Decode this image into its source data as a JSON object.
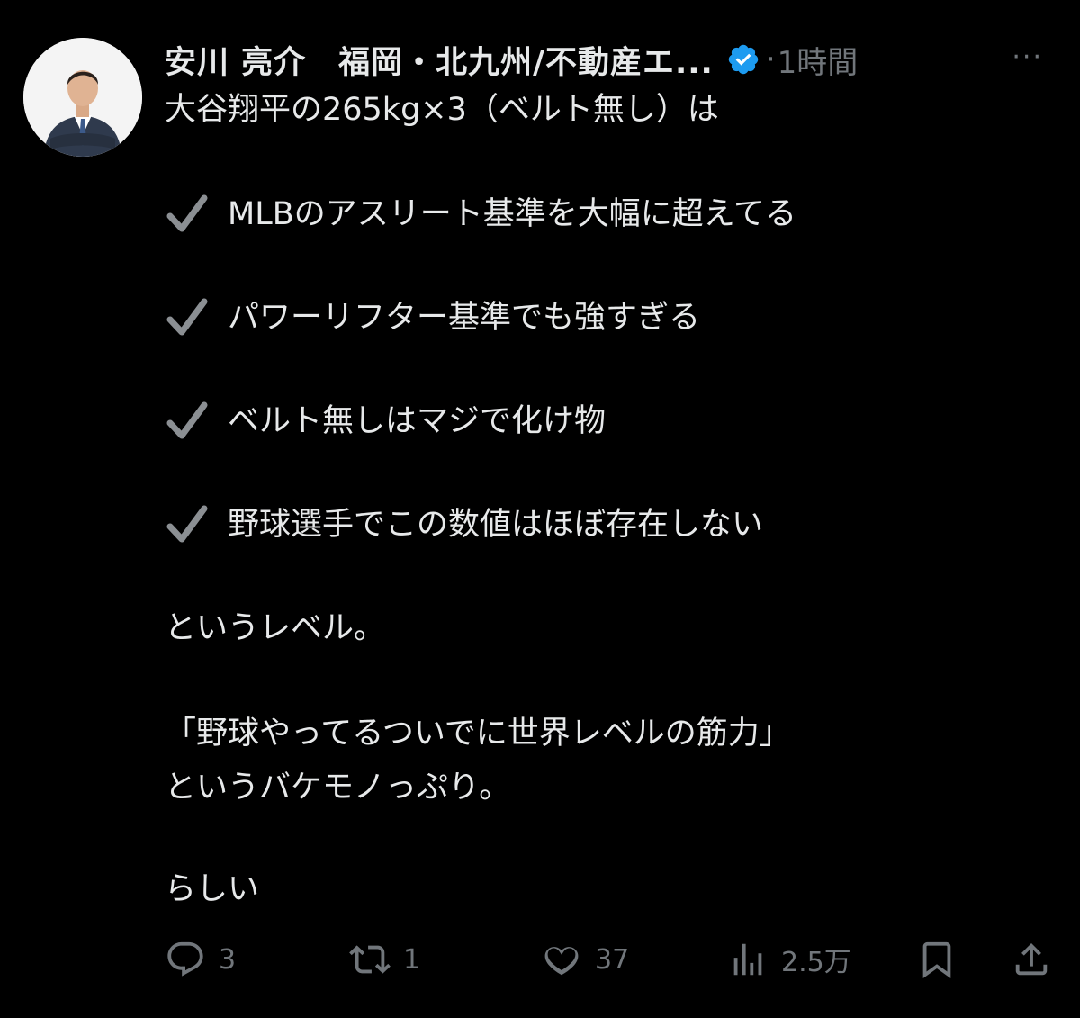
{
  "post": {
    "author_name": "安川 亮介　福岡・北九州/不動産エ...",
    "verified": true,
    "separator": "·",
    "time": "1時間",
    "more_label": "···",
    "line1": "大谷翔平の265kg×3（ベルト無し）は",
    "checks": [
      "MLBのアスリート基準を大幅に超えてる",
      "パワーリフター基準でも強すぎる",
      "ベルト無しはマジで化け物",
      "野球選手でこの数値はほぼ存在しない"
    ],
    "line_level": "というレベル。",
    "quote1": "「野球やってるついでに世界レベルの筋力」",
    "quote2": "というバケモノっぷり。",
    "closing": "らしい"
  },
  "actions": {
    "replies": "3",
    "reposts": "1",
    "likes": "37",
    "views": "2.5万"
  },
  "colors": {
    "background": "#000000",
    "text": "#e7e9ea",
    "secondary": "#71767b",
    "verified_badge": "#1d9bf0",
    "check_mark": "#8b8f93"
  },
  "icons": {
    "check": "check-icon",
    "reply": "reply-icon",
    "repost": "repost-icon",
    "like": "heart-icon",
    "views": "views-icon",
    "bookmark": "bookmark-icon",
    "share": "share-icon",
    "verified": "verified-badge-icon",
    "more": "more-icon"
  }
}
